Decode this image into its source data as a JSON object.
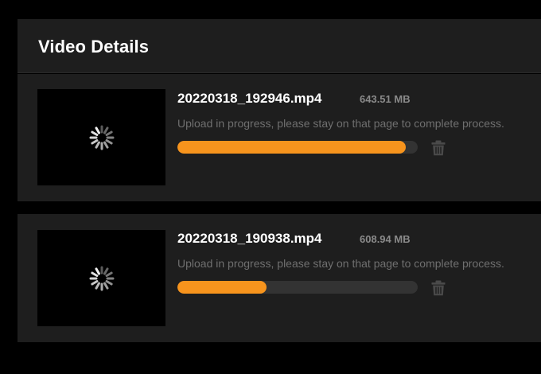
{
  "header": {
    "title": "Video Details"
  },
  "uploads": [
    {
      "file_name": "20220318_192946.mp4",
      "file_size": "643.51 MB",
      "status": "Upload in progress, please stay on that page to complete process.",
      "progress": 0.95,
      "thumbnail_icon": "loading-spinner-icon",
      "delete_icon": "trash-icon"
    },
    {
      "file_name": "20220318_190938.mp4",
      "file_size": "608.94 MB",
      "status": "Upload in progress, please stay on that page to complete process.",
      "progress": 0.37,
      "thumbnail_icon": "loading-spinner-icon",
      "delete_icon": "trash-icon"
    }
  ],
  "colors": {
    "page_background": "#000000",
    "panel_background": "#1e1e1e",
    "progress_fill": "#f7941d",
    "progress_track": "#333333",
    "muted_text": "#6f6f6f",
    "size_text": "#8a8a8a"
  }
}
